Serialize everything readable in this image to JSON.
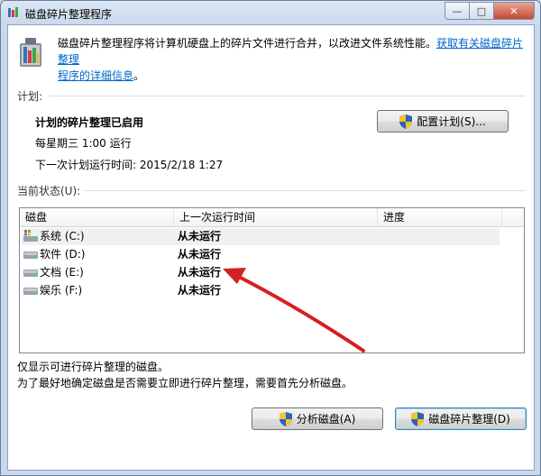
{
  "window": {
    "title": "磁盘碎片整理程序",
    "caption": {
      "minimize": "—",
      "maximize": "□",
      "close": "✕"
    }
  },
  "header": {
    "description": "磁盘碎片整理程序将计算机硬盘上的碎片文件进行合并，以改进文件系统性能。",
    "link_part1": "获取有关磁盘碎片整理",
    "link_part2": "程序的详细信息",
    "link_suffix": "。"
  },
  "schedule": {
    "group_label": "计划:",
    "status": "计划的碎片整理已启用",
    "frequency": "每星期三  1:00 运行",
    "next_run": "下一次计划运行时间: 2015/2/18 1:27",
    "configure_button": "配置计划(S)..."
  },
  "current_status": {
    "group_label": "当前状态(U):",
    "columns": [
      "磁盘",
      "上一次运行时间",
      "进度"
    ],
    "drives": [
      {
        "name": "系统 (C:)",
        "last_run": "从未运行",
        "progress": "",
        "icon": "system-drive-icon"
      },
      {
        "name": "软件 (D:)",
        "last_run": "从未运行",
        "progress": "",
        "icon": "hard-drive-icon"
      },
      {
        "name": "文档 (E:)",
        "last_run": "从未运行",
        "progress": "",
        "icon": "hard-drive-icon"
      },
      {
        "name": "娱乐 (F:)",
        "last_run": "从未运行",
        "progress": "",
        "icon": "hard-drive-icon"
      }
    ]
  },
  "notes": {
    "line1": "仅显示可进行碎片整理的磁盘。",
    "line2": "为了最好地确定磁盘是否需要立即进行碎片整理，需要首先分析磁盘。"
  },
  "actions": {
    "analyze": "分析磁盘(A)",
    "defragment": "磁盘碎片整理(D)"
  },
  "colors": {
    "link": "#0066cc",
    "annotation_arrow": "#d42020",
    "shield_blue": "#2a64b4",
    "shield_yellow": "#f2c230"
  }
}
